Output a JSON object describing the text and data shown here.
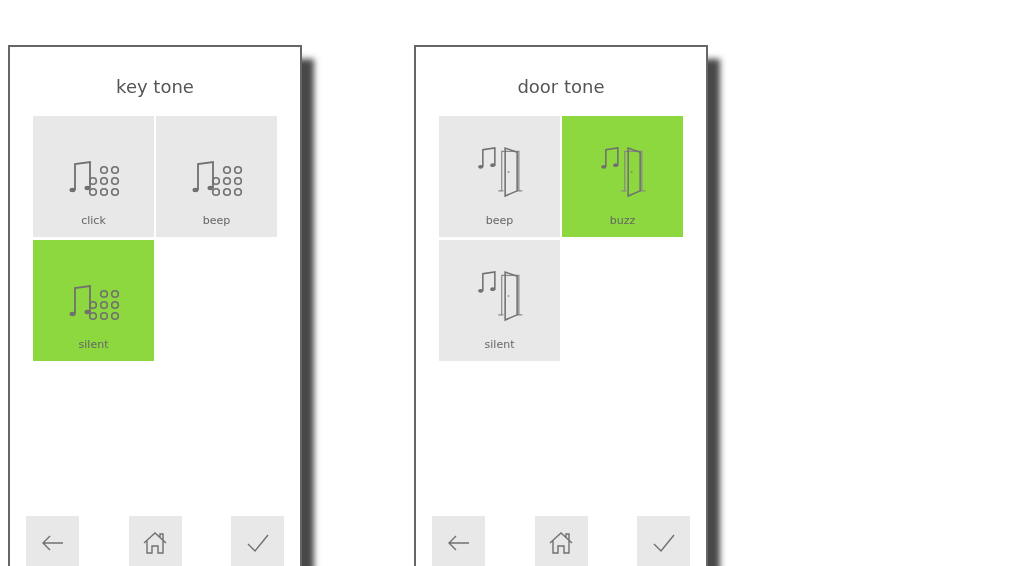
{
  "screens": [
    {
      "title": "key tone",
      "options": [
        {
          "label": "click",
          "selected": false,
          "kind": "keypad"
        },
        {
          "label": "beep",
          "selected": false,
          "kind": "keypad"
        },
        {
          "label": "silent",
          "selected": true,
          "kind": "keypad"
        }
      ],
      "buttons": [
        {
          "kind": "back"
        },
        {
          "kind": "home"
        },
        {
          "kind": "confirm"
        }
      ]
    },
    {
      "title": "door tone",
      "options": [
        {
          "label": "beep",
          "selected": false,
          "kind": "door"
        },
        {
          "label": "buzz",
          "selected": true,
          "kind": "door"
        },
        {
          "label": "silent",
          "selected": false,
          "kind": "door"
        }
      ],
      "buttons": [
        {
          "kind": "back"
        },
        {
          "kind": "home"
        },
        {
          "kind": "confirm"
        }
      ]
    }
  ]
}
